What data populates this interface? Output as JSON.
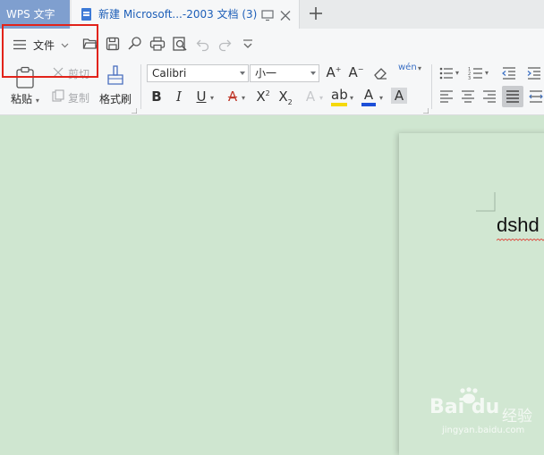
{
  "tabs": {
    "app_label": "WPS 文字",
    "document_label": "新建 Microsoft...-2003 文档 (3)"
  },
  "toolbar": {
    "file_menu_label": "文件",
    "cut_label": "剪切",
    "copy_label": "复制",
    "paste_label": "粘贴",
    "format_painter_label": "格式刷",
    "font_name": "Calibri",
    "font_size": "小一",
    "pinyin_glyph": "wén"
  },
  "document": {
    "body_text": "dshd"
  },
  "watermark": {
    "logo_text": "Bai du",
    "brand_cn": "经验",
    "url": "jingyan.baidu.com"
  },
  "colors": {
    "active_app_tab": "#7f9fcf",
    "accent_blue": "#1e5fb8",
    "highlight_red": "#e2231a",
    "canvas_green": "#cfe6d0"
  }
}
